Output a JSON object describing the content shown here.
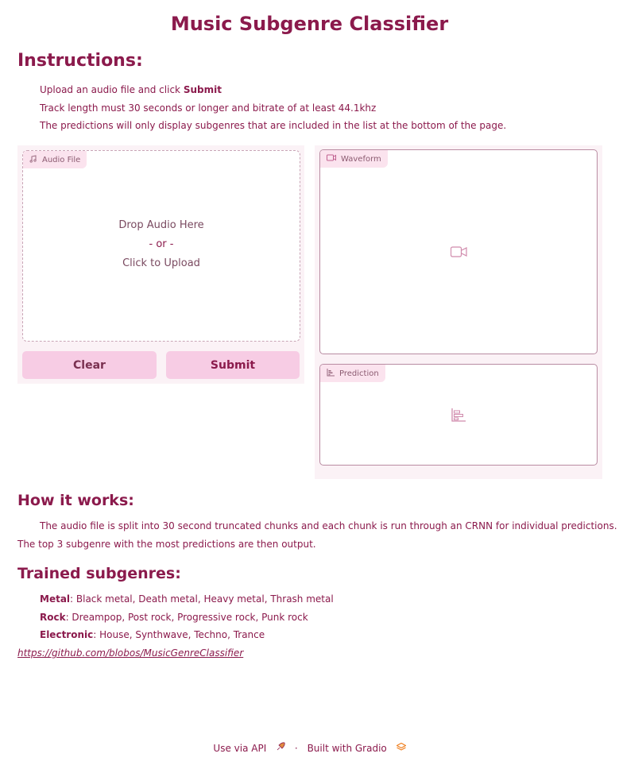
{
  "title": "Music Subgenre Classifier",
  "instructions": {
    "heading": "Instructions:",
    "lines": [
      {
        "pre": "Upload an audio file and click ",
        "bold": "Submit"
      },
      {
        "text": "Track length must 30 seconds or longer and bitrate of at least 44.1khz"
      },
      {
        "text": "The predictions will only display subgenres that are included in the list at the bottom of the page."
      }
    ]
  },
  "audio_input": {
    "label": "Audio File",
    "drop_text": "Drop Audio Here",
    "or_text": "- or -",
    "click_text": "Click to Upload",
    "icon": "music-note-icon"
  },
  "buttons": {
    "clear": "Clear",
    "submit": "Submit"
  },
  "waveform": {
    "label": "Waveform",
    "icon": "video-icon"
  },
  "prediction": {
    "label": "Prediction",
    "icon": "bar-chart-icon"
  },
  "how_it_works": {
    "heading": "How it works:",
    "line1": "The audio file is split into 30 second truncated chunks and each chunk is run through an CRNN for individual predictions.",
    "line2": "The top 3 subgenre with the most predictions are then output."
  },
  "trained": {
    "heading": "Trained subgenres:",
    "items": [
      {
        "name": "Metal",
        "list": ": Black metal, Death metal, Heavy metal, Thrash metal"
      },
      {
        "name": "Rock",
        "list": ": Dreampop, Post rock, Progressive rock, Punk rock"
      },
      {
        "name": "Electronic",
        "list": ": House, Synthwave, Techno, Trance"
      }
    ],
    "link": "https://github.com/blobos/MusicGenreClassifier"
  },
  "footer": {
    "api": "Use via API",
    "separator": "·",
    "built": "Built with Gradio"
  },
  "colors": {
    "accent": "#8b1a4c",
    "button": "#f7cce4",
    "panel_bg": "#fbf2f6"
  }
}
